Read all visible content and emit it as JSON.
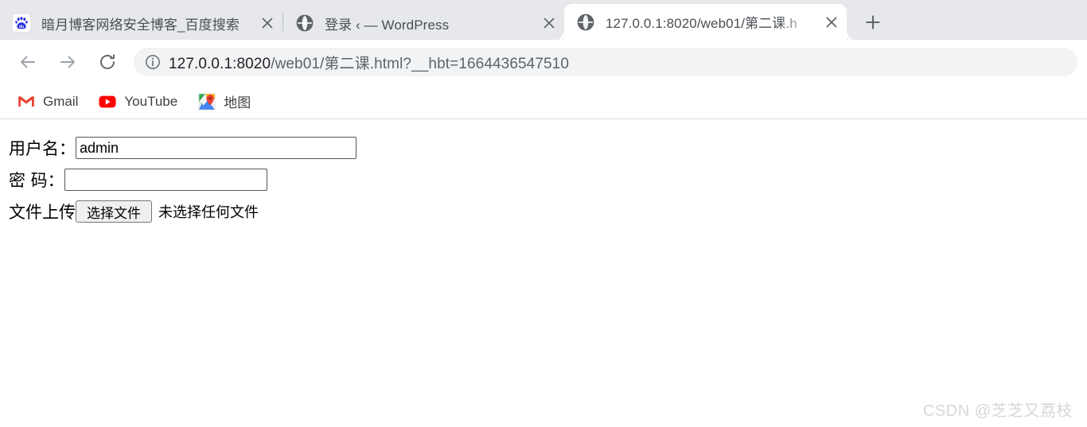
{
  "browser": {
    "tabs": [
      {
        "title": "暗月博客网络安全博客_百度搜索",
        "favicon": "baidu-favicon",
        "active": false,
        "close_label": "✕"
      },
      {
        "title": "登录 ‹ — WordPress",
        "favicon": "globe-favicon",
        "active": false,
        "close_label": "✕"
      },
      {
        "title": "127.0.0.1:8020/web01/第二课.h",
        "favicon": "globe-favicon",
        "active": true,
        "close_label": "✕"
      }
    ],
    "new_tab_label": "+",
    "toolbar": {
      "back_label": "←",
      "forward_label": "→",
      "reload_label": "⟳",
      "site_info_label": "ⓘ",
      "url_host": "127.0.0.1:8020",
      "url_path": "/web01/第二课.html?__hbt=1664436547510",
      "url_full": "127.0.0.1:8020/web01/第二课.html?__hbt=1664436547510"
    },
    "bookmarks": [
      {
        "label": "Gmail",
        "icon": "gmail-icon"
      },
      {
        "label": "YouTube",
        "icon": "youtube-icon"
      },
      {
        "label": "地图",
        "icon": "google-maps-icon"
      }
    ]
  },
  "page": {
    "form": {
      "username_label": "用户名：",
      "username_value": "admin",
      "password_label": "密 码：",
      "password_value": "",
      "file_label": "文件上传",
      "file_button_label": "选择文件",
      "file_status_text": "未选择任何文件"
    }
  },
  "watermark": {
    "text": "CSDN @芝芝又荔枝"
  },
  "colors": {
    "tabstrip_bg": "#e6e8eb",
    "active_tab_bg": "#ffffff",
    "omnibox_bg": "#f1f3f4",
    "url_text": "#5f6368",
    "url_host_text": "#202124",
    "gmail_red": "#ea4335",
    "youtube_red": "#ff0000",
    "baidu_blue": "#2932e1",
    "watermark_gray": "#d7d7d7"
  }
}
